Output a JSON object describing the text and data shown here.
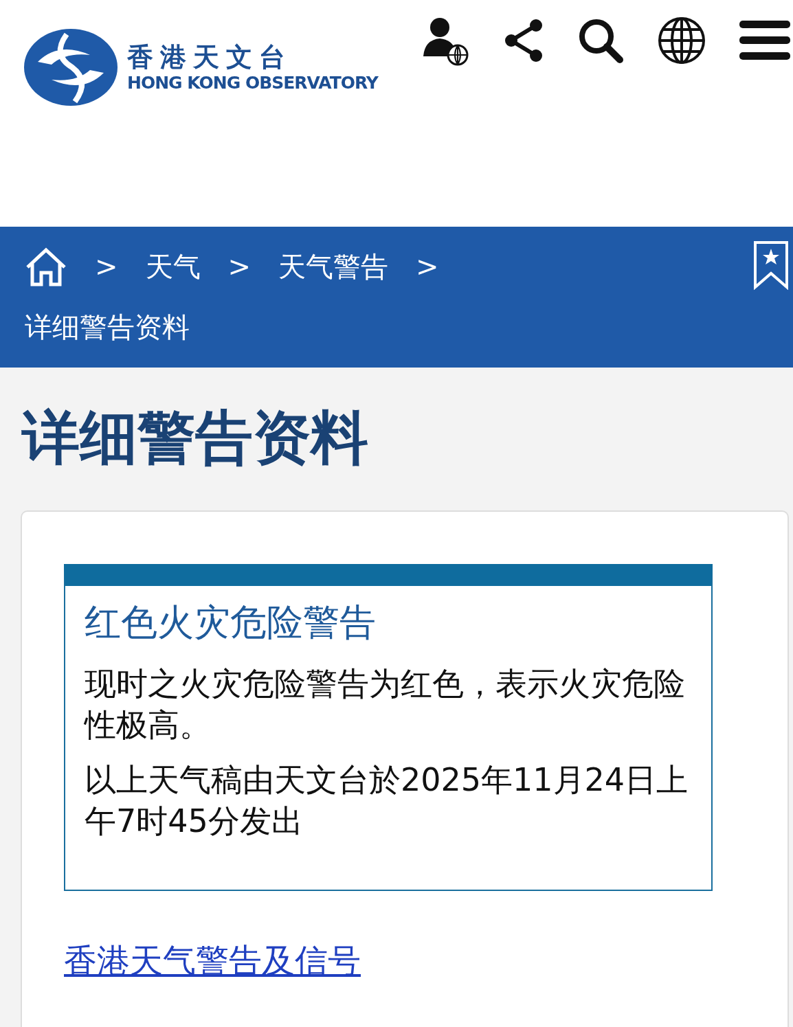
{
  "header": {
    "logo": {
      "name_zh": "香港天文台",
      "name_en": "HONG KONG OBSERVATORY"
    },
    "tools": [
      {
        "kind": "account"
      },
      {
        "kind": "share"
      },
      {
        "kind": "search"
      },
      {
        "kind": "language"
      },
      {
        "kind": "menu"
      }
    ]
  },
  "breadcrumb": {
    "separator": ">",
    "items": [
      "天气",
      "天气警告",
      "详细警告资料"
    ]
  },
  "page_title": "详细警告资料",
  "warning": {
    "title": "红色火灾危险警告",
    "paragraphs": [
      "现时之火灾危险警告为红色，表示火灾危险性极高。",
      "以上天气稿由天文台於2025年11月24日上午7时45分发出"
    ]
  },
  "link": "香港天气警告及信号"
}
